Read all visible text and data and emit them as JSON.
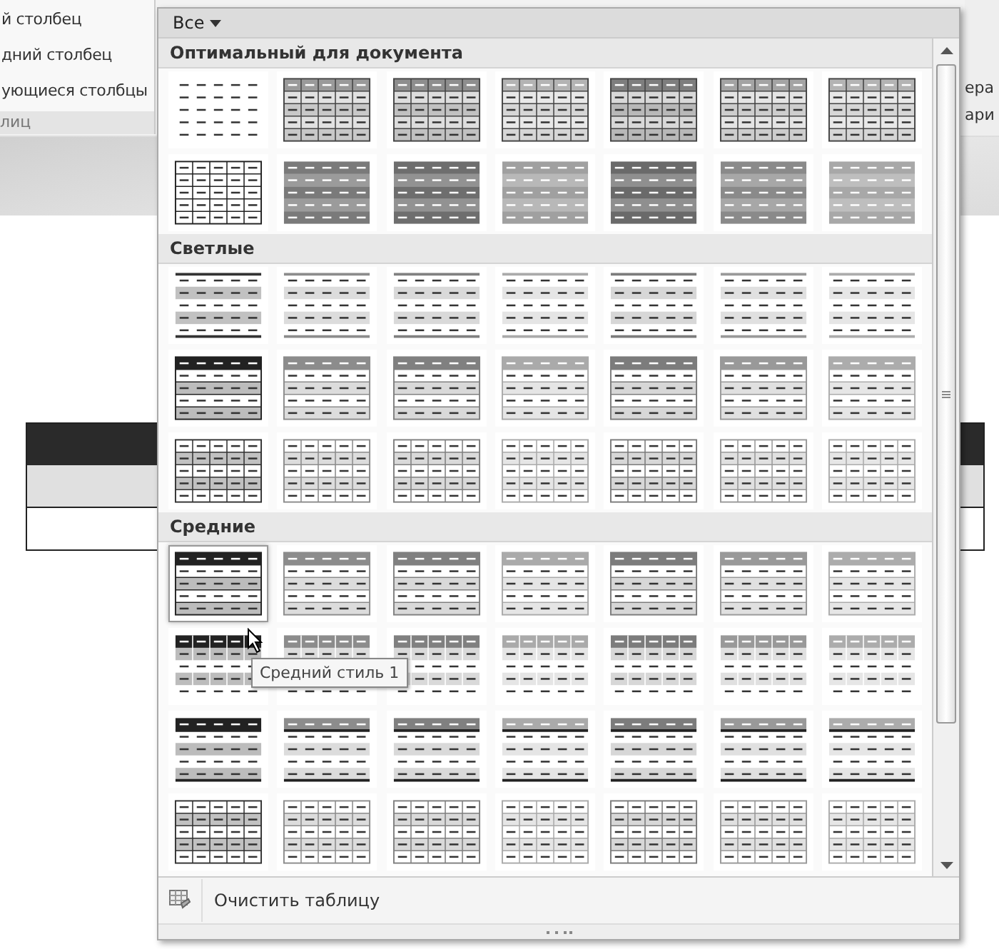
{
  "ribbon": {
    "left_items": [
      "й столбец",
      "дний столбец",
      "ующиеся столбцы"
    ],
    "left_group": "лиц",
    "right_items": [
      "ера",
      "ари"
    ]
  },
  "gallery": {
    "filter": "Все",
    "sections": [
      {
        "title": "Оптимальный для документа",
        "rows": [
          [
            {
              "kind": "plain",
              "color": "#333333",
              "selected": false
            },
            {
              "kind": "shaded-grid",
              "color": "#9a9a9a",
              "selected": false
            },
            {
              "kind": "shaded-grid",
              "color": "#8e8e8e",
              "selected": false
            },
            {
              "kind": "shaded-grid",
              "color": "#b4b4b4",
              "selected": false
            },
            {
              "kind": "shaded-grid",
              "color": "#7e7e7e",
              "selected": false
            },
            {
              "kind": "shaded-grid",
              "color": "#a4a4a4",
              "selected": false
            },
            {
              "kind": "shaded-grid",
              "color": "#b4b4b4",
              "selected": false
            }
          ],
          [
            {
              "kind": "grid",
              "color": "#222222",
              "selected": false
            },
            {
              "kind": "shaded-bands",
              "color": "#7a7a7a",
              "selected": false
            },
            {
              "kind": "shaded-bands",
              "color": "#6e6e6e",
              "selected": false
            },
            {
              "kind": "shaded-bands",
              "color": "#a0a0a0",
              "selected": false
            },
            {
              "kind": "shaded-bands",
              "color": "#6a6a6a",
              "selected": false
            },
            {
              "kind": "shaded-bands",
              "color": "#8a8a8a",
              "selected": false
            },
            {
              "kind": "shaded-bands",
              "color": "#a8a8a8",
              "selected": false
            }
          ]
        ]
      },
      {
        "title": "Светлые",
        "rows": [
          [
            {
              "kind": "light-bands",
              "color": "#333333",
              "selected": false
            },
            {
              "kind": "light-bands",
              "color": "#8c8c8c",
              "selected": false
            },
            {
              "kind": "light-bands",
              "color": "#808080",
              "selected": false
            },
            {
              "kind": "light-bands",
              "color": "#aaaaaa",
              "selected": false
            },
            {
              "kind": "light-bands",
              "color": "#7c7c7c",
              "selected": false
            },
            {
              "kind": "light-bands",
              "color": "#999999",
              "selected": false
            },
            {
              "kind": "light-bands",
              "color": "#acacac",
              "selected": false
            }
          ],
          [
            {
              "kind": "header-lines",
              "color": "#222222",
              "selected": false
            },
            {
              "kind": "header-lines",
              "color": "#8c8c8c",
              "selected": false
            },
            {
              "kind": "header-lines",
              "color": "#808080",
              "selected": false
            },
            {
              "kind": "header-lines",
              "color": "#aaaaaa",
              "selected": false
            },
            {
              "kind": "header-lines",
              "color": "#7c7c7c",
              "selected": false
            },
            {
              "kind": "header-lines",
              "color": "#999999",
              "selected": false
            },
            {
              "kind": "header-lines",
              "color": "#acacac",
              "selected": false
            }
          ],
          [
            {
              "kind": "grid-bands",
              "color": "#333333",
              "selected": false
            },
            {
              "kind": "grid-bands",
              "color": "#8c8c8c",
              "selected": false
            },
            {
              "kind": "grid-bands",
              "color": "#808080",
              "selected": false
            },
            {
              "kind": "grid-bands",
              "color": "#aaaaaa",
              "selected": false
            },
            {
              "kind": "grid-bands",
              "color": "#7c7c7c",
              "selected": false
            },
            {
              "kind": "grid-bands",
              "color": "#999999",
              "selected": false
            },
            {
              "kind": "grid-bands",
              "color": "#acacac",
              "selected": false
            }
          ]
        ]
      },
      {
        "title": "Средние",
        "rows": [
          [
            {
              "kind": "header-lines",
              "color": "#222222",
              "selected": true
            },
            {
              "kind": "header-lines",
              "color": "#8c8c8c",
              "selected": false
            },
            {
              "kind": "header-lines",
              "color": "#808080",
              "selected": false
            },
            {
              "kind": "header-lines",
              "color": "#aaaaaa",
              "selected": false
            },
            {
              "kind": "header-lines",
              "color": "#7c7c7c",
              "selected": false
            },
            {
              "kind": "header-lines",
              "color": "#999999",
              "selected": false
            },
            {
              "kind": "header-lines",
              "color": "#acacac",
              "selected": false
            }
          ],
          [
            {
              "kind": "header-bands",
              "color": "#222222",
              "selected": false
            },
            {
              "kind": "header-bands",
              "color": "#8c8c8c",
              "selected": false
            },
            {
              "kind": "header-bands",
              "color": "#808080",
              "selected": false
            },
            {
              "kind": "header-bands",
              "color": "#aaaaaa",
              "selected": false
            },
            {
              "kind": "header-bands",
              "color": "#7c7c7c",
              "selected": false
            },
            {
              "kind": "header-bands",
              "color": "#999999",
              "selected": false
            },
            {
              "kind": "header-bands",
              "color": "#acacac",
              "selected": false
            }
          ],
          [
            {
              "kind": "header-rule",
              "color": "#222222",
              "selected": false
            },
            {
              "kind": "header-rule",
              "color": "#8c8c8c",
              "selected": false
            },
            {
              "kind": "header-rule",
              "color": "#808080",
              "selected": false
            },
            {
              "kind": "header-rule",
              "color": "#aaaaaa",
              "selected": false
            },
            {
              "kind": "header-rule",
              "color": "#7c7c7c",
              "selected": false
            },
            {
              "kind": "header-rule",
              "color": "#999999",
              "selected": false
            },
            {
              "kind": "header-rule",
              "color": "#acacac",
              "selected": false
            }
          ],
          [
            {
              "kind": "grid-bands",
              "color": "#333333",
              "selected": false
            },
            {
              "kind": "grid-bands",
              "color": "#8c8c8c",
              "selected": false
            },
            {
              "kind": "grid-bands",
              "color": "#808080",
              "selected": false
            },
            {
              "kind": "grid-bands",
              "color": "#aaaaaa",
              "selected": false
            },
            {
              "kind": "grid-bands",
              "color": "#7c7c7c",
              "selected": false
            },
            {
              "kind": "grid-bands",
              "color": "#999999",
              "selected": false
            },
            {
              "kind": "grid-bands",
              "color": "#acacac",
              "selected": false
            }
          ]
        ]
      }
    ],
    "footer_label": "Очистить таблицу"
  },
  "tooltip": "Средний стиль 1"
}
